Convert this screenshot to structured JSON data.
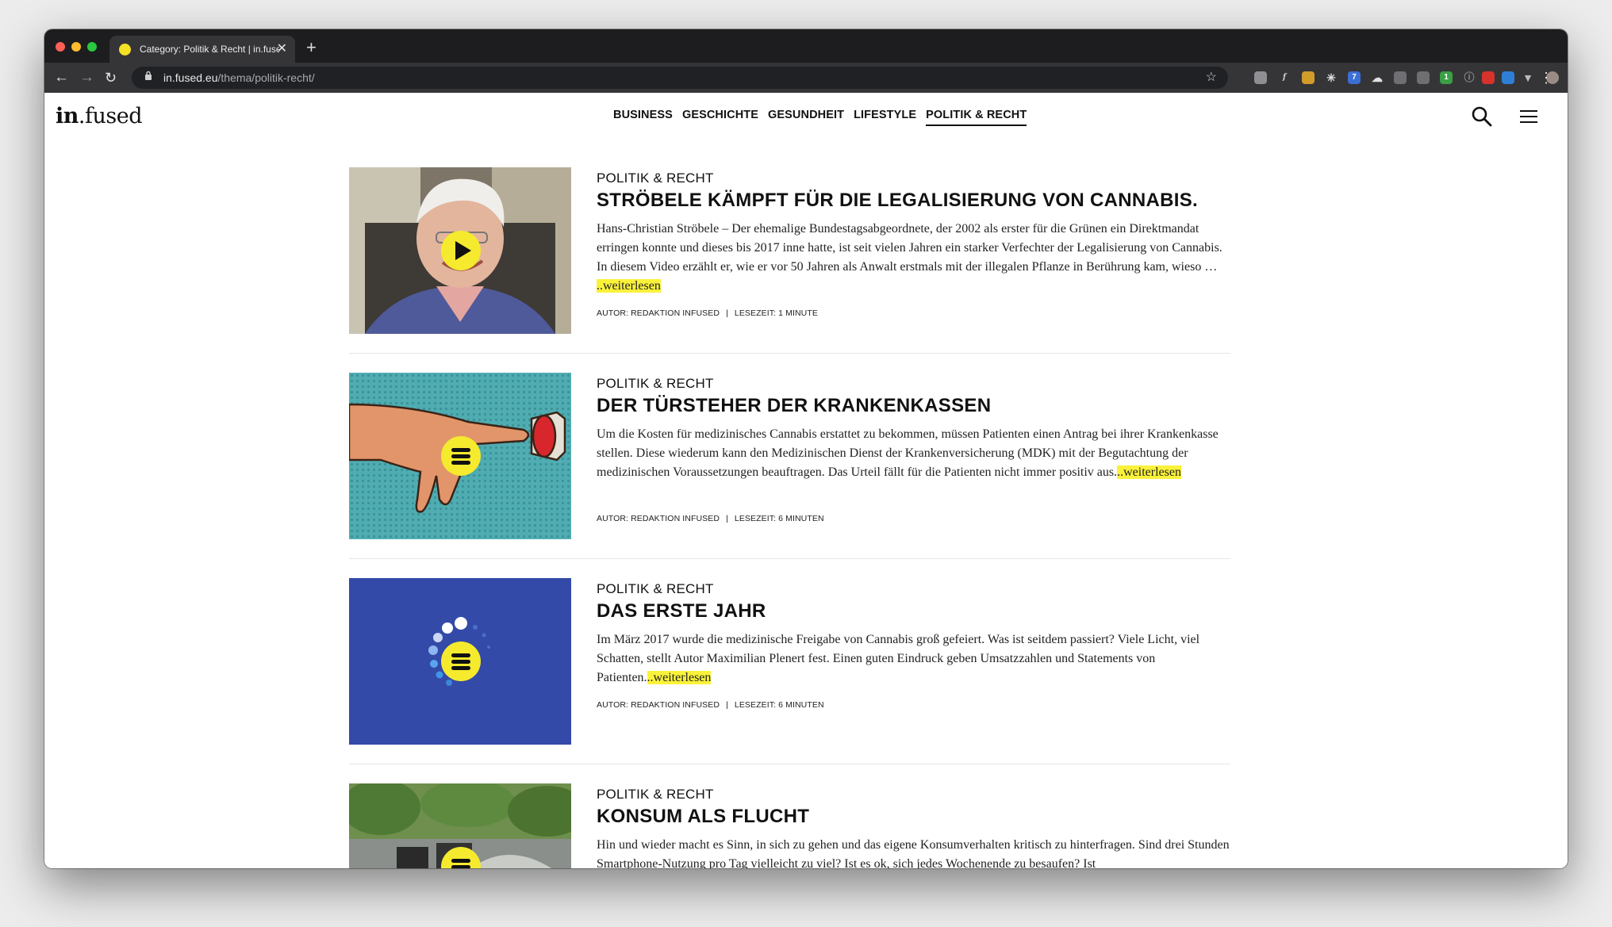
{
  "browser": {
    "tab_title": "Category: Politik & Recht | in.fused",
    "tab_close": "✕",
    "new_tab": "+",
    "url_host": "in.fused.eu",
    "url_path": "/thema/politik-recht/",
    "extension_badges": [
      "7",
      "1"
    ]
  },
  "site": {
    "logo_bold": "in",
    "logo_rest": ".fused",
    "nav": [
      "BUSINESS",
      "GESCHICHTE",
      "GESUNDHEIT",
      "LIFESTYLE",
      "POLITIK & RECHT"
    ],
    "active_nav": "POLITIK & RECHT"
  },
  "articles": [
    {
      "category": "POLITIK & RECHT",
      "title": "STRÖBELE KÄMPFT FÜR DIE LEGALISIERUNG VON CANNABIS.",
      "excerpt": " Hans-Christian Ströbele – Der ehemalige Bundestagsabgeordnete, der 2002 als erster für die Grünen ein Direktmandat erringen konnte und dieses bis 2017 inne hatte, ist seit vielen Jahren ein starker Verfechter der Legalisierung von Cannabis. In diesem Video erzählt er, wie er vor 50 Jahren als Anwalt erstmals mit der illegalen Pflanze in Berührung kam, wieso … ",
      "readmore": "..weiterlesen",
      "author": "AUTOR: REDAKTION INFUSED",
      "readtime": "LESEZEIT: 1 MINUTE",
      "badge": "play-icon"
    },
    {
      "category": "POLITIK & RECHT",
      "title": "DER TÜRSTEHER DER KRANKENKASSEN",
      "excerpt": "Um die Kosten für medizinisches Cannabis erstattet zu bekommen, müssen Patienten einen Antrag bei ihrer Krankenkasse stellen. Diese wiederum kann den Medizinischen Dienst der Krankenversicherung (MDK) mit der Begutachtung der medizinischen Voraussetzungen beauftragen. Das Urteil fällt für die Patienten nicht immer positiv aus.",
      "readmore": "..weiterlesen",
      "author": "AUTOR: REDAKTION INFUSED",
      "readtime": "LESEZEIT: 6 MINUTEN",
      "badge": "text-article-icon"
    },
    {
      "category": "POLITIK & RECHT",
      "title": "DAS ERSTE JAHR",
      "excerpt": "Im März 2017 wurde die medizinische Freigabe von Cannabis groß gefeiert. Was ist seitdem passiert? Viele Licht, viel Schatten, stellt Autor Maximilian Plenert fest. Einen guten Eindruck geben Umsatzzahlen und Statements von Patienten.",
      "readmore": "..weiterlesen",
      "author": "AUTOR: REDAKTION INFUSED",
      "readtime": "LESEZEIT: 6 MINUTEN",
      "badge": "text-article-icon"
    },
    {
      "category": "POLITIK & RECHT",
      "title": "KONSUM ALS FLUCHT",
      "excerpt": "Hin und wieder macht es Sinn, in sich zu gehen und das eigene Konsumverhalten kritisch zu hinterfragen. Sind drei Stunden Smartphone-Nutzung pro Tag vielleicht zu viel? Ist es ok, sich jedes Wochenende zu besaufen? Ist",
      "readmore": "",
      "author": "",
      "readtime": "",
      "badge": "text-article-icon"
    }
  ],
  "colors": {
    "highlight": "#faf23a",
    "badge_yellow": "#f5ea2e",
    "chrome_dark": "#1d1d1f",
    "chrome_toolbar": "#353538"
  }
}
